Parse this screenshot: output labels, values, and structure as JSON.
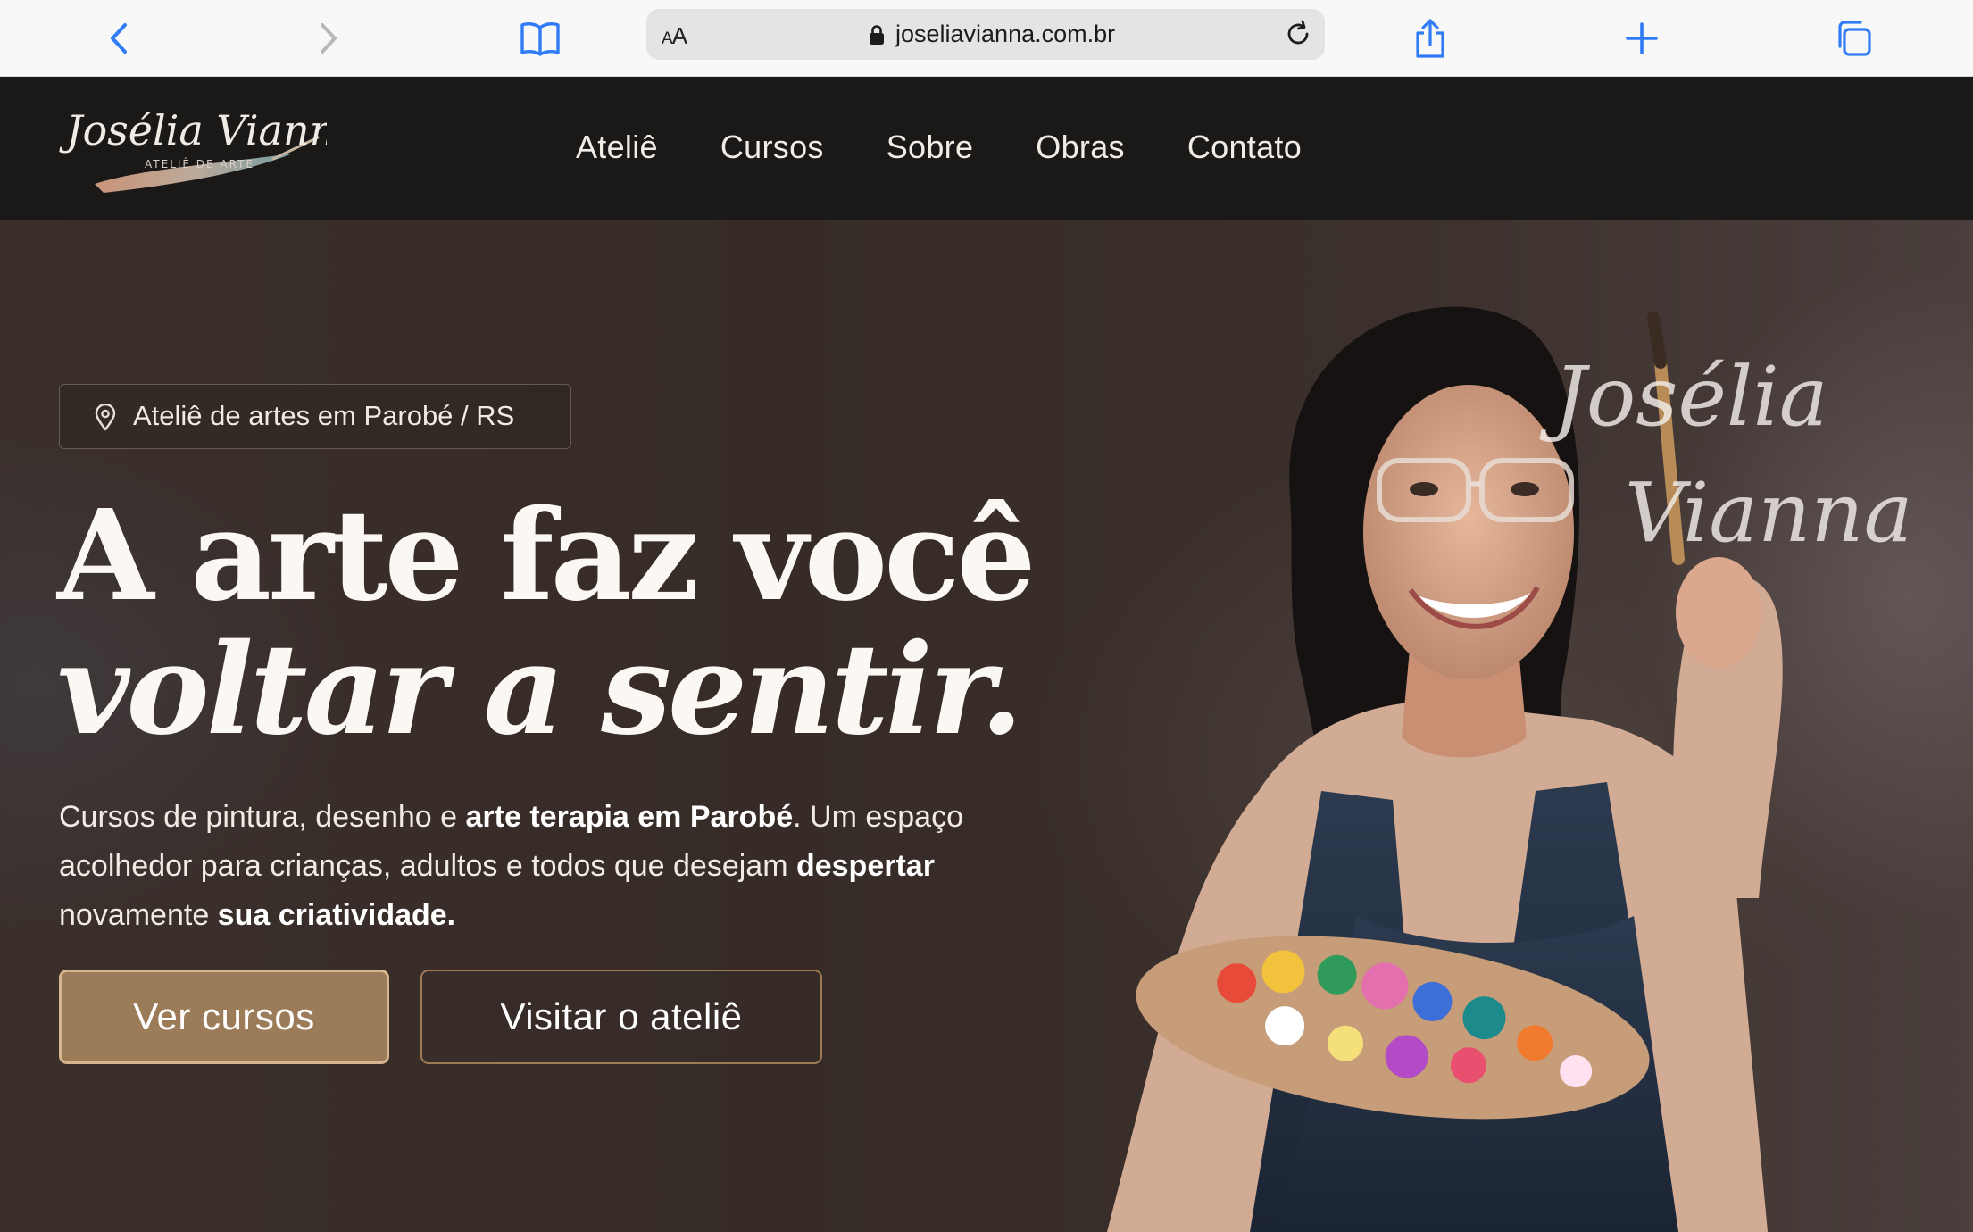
{
  "browser": {
    "address_prefix_big": "A",
    "address_prefix_small": "A",
    "url": "joseliavianna.com.br",
    "icons": [
      "back-icon",
      "forward-icon",
      "bookmarks-icon",
      "lock-icon",
      "reload-icon",
      "share-icon",
      "new-tab-icon",
      "tabs-icon"
    ]
  },
  "site": {
    "logo": {
      "script": "Josélia Vianna",
      "tagline": "ATELIÊ DE ARTE"
    },
    "nav": [
      "Ateliê",
      "Cursos",
      "Sobre",
      "Obras",
      "Contato"
    ]
  },
  "hero": {
    "location": "Ateliê de artes em Parobé / RS",
    "headline_line1": "A arte faz você",
    "headline_line2": "voltar a sentir.",
    "desc": {
      "p1": "Cursos de pintura, desenho e ",
      "b1": "arte terapia em Parobé",
      "p2": ". Um espaço acolhedor para crianças, adultos e todos que desejam ",
      "b2": "despertar",
      "p3": " novamente ",
      "b3": "sua criatividade."
    },
    "btn_primary": "Ver cursos",
    "btn_secondary": "Visitar o ateliê",
    "signature": "Josélia Vianna"
  },
  "colors": {
    "nav_bg": "#1a1918",
    "hero_bg": "#362b27",
    "accent": "#9c7b58",
    "browser_blue": "#2f7cf6"
  }
}
